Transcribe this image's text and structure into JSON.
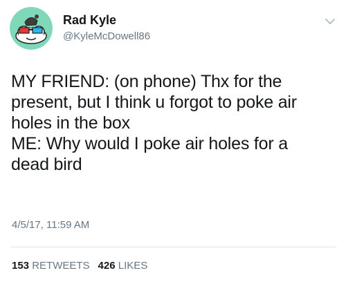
{
  "author": {
    "name": "Rad Kyle",
    "handle": "@KyleMcDowell86"
  },
  "tweet": {
    "text": "MY FRIEND: (on phone) Thx for the\npresent, but I think u forgot to poke air\nholes in the box\nME: Why would I poke air holes for a\ndead bird",
    "timestamp": "4/5/17, 11:59 AM"
  },
  "stats": {
    "retweets_count": "153",
    "retweets_label": "RETWEETS",
    "likes_count": "426",
    "likes_label": "LIKES"
  },
  "icons": {
    "menu": "chevron-down-icon"
  },
  "colors": {
    "avatar_bg": "#7fd8b8",
    "secondary_text": "#657786",
    "divider": "#e1e8ed"
  }
}
